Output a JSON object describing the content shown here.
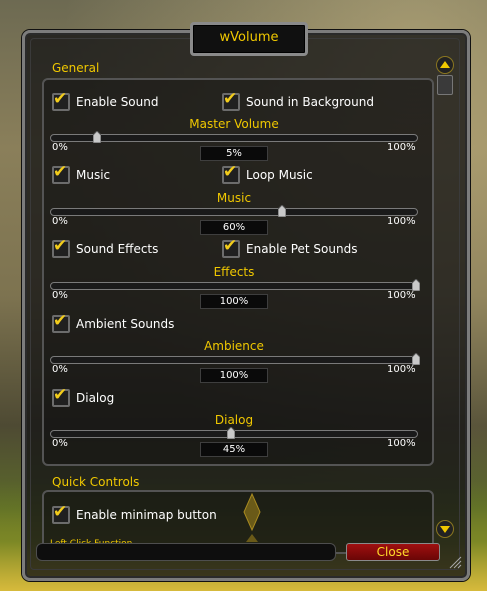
{
  "window": {
    "title": "wVolume"
  },
  "general": {
    "title": "General",
    "enable_sound": {
      "label": "Enable Sound",
      "checked": true
    },
    "sound_in_background": {
      "label": "Sound in Background",
      "checked": true
    },
    "master": {
      "label": "Master Volume",
      "min": "0%",
      "max": "100%",
      "value": "5%",
      "fraction": 0.05
    },
    "music": {
      "label": "Music",
      "checked": true
    },
    "loop_music": {
      "label": "Loop Music",
      "checked": true
    },
    "music_slider": {
      "label": "Music",
      "min": "0%",
      "max": "100%",
      "value": "60%",
      "fraction": 0.6
    },
    "sound_effects": {
      "label": "Sound Effects",
      "checked": true
    },
    "enable_pet_sounds": {
      "label": "Enable Pet Sounds",
      "checked": true
    },
    "effects_slider": {
      "label": "Effects",
      "min": "0%",
      "max": "100%",
      "value": "100%",
      "fraction": 1.0
    },
    "ambient_sounds": {
      "label": "Ambient Sounds",
      "checked": true
    },
    "ambience_slider": {
      "label": "Ambience",
      "min": "0%",
      "max": "100%",
      "value": "100%",
      "fraction": 1.0
    },
    "dialog": {
      "label": "Dialog",
      "checked": true
    },
    "dialog_slider": {
      "label": "Dialog",
      "min": "0%",
      "max": "100%",
      "value": "45%",
      "fraction": 0.45
    }
  },
  "quick_controls": {
    "title": "Quick Controls",
    "enable_minimap_button": {
      "label": "Enable minimap button",
      "checked": true
    },
    "left_click_function": "Left Click Function"
  },
  "footer": {
    "close_label": "Close"
  },
  "colors": {
    "accent": "#f0c800",
    "close_bg": "#8a0c0c"
  }
}
